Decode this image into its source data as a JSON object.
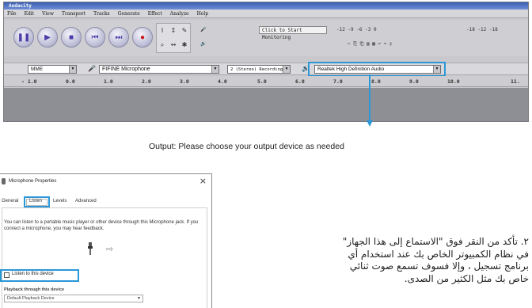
{
  "audacity": {
    "title": "Audacity",
    "menu": [
      "File",
      "Edit",
      "View",
      "Transport",
      "Tracks",
      "Generate",
      "Effect",
      "Analyze",
      "Help"
    ],
    "click_to_start_monitoring": "Click to Start Monitoring",
    "meter_scale_1": "-12 -9 -6 -3 0",
    "meter_scale_2": "-18 -12 -18",
    "audio_host": "MME",
    "recording_device": "FIFINE Microphone",
    "recording_channels": "2 (Stereo) Recording",
    "output_device": "Realtek High Definition Audio",
    "ruler_ticks": [
      "- 1.0",
      "0.0",
      "1.0",
      "2.0",
      "3.0",
      "4.0",
      "5.0",
      "6.0",
      "7.0",
      "8.0",
      "9.0",
      "10.0",
      "11."
    ]
  },
  "output_caption": "Output: Please choose your output device as needed",
  "dialog": {
    "title": "Microphone Properties",
    "close": "×",
    "tabs": [
      "General",
      "Listen",
      "Levels",
      "Advanced"
    ],
    "description": "You can listen to a portable music player or other device through this Microphone jack. If you connect a microphone, you may hear feedback.",
    "listen_checkbox_label": "Listen to this device",
    "playback_label": "Playback through this device",
    "playback_value": "Default Playback Device"
  },
  "note_lines": [
    "٢. تأكد من النقر فوق \"الاستماع إلى هذا الجهاز\"",
    "في نظام الكمبيوتر الخاص بك عند استخدام أي",
    "برنامج تسجيل ، وإلا فسوف تسمع صوت ثنائي",
    "خاص بك مثل الكثير من الصدى."
  ],
  "colors": {
    "highlight": "#2b97d7"
  }
}
